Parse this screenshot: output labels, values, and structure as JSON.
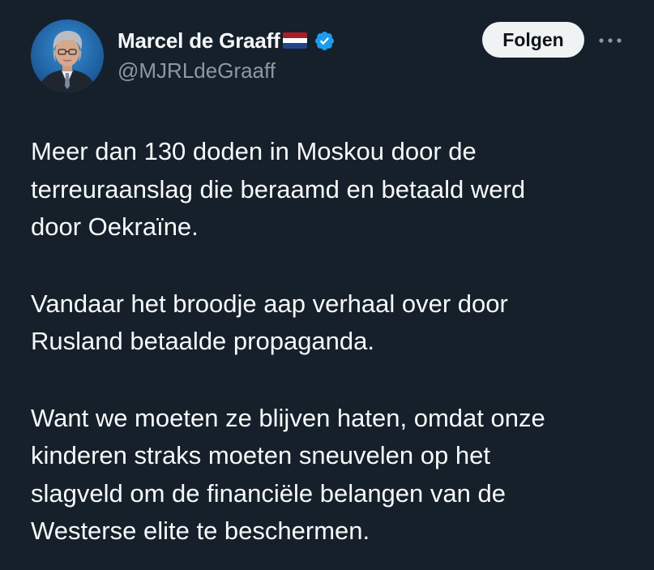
{
  "author": {
    "display_name": "Marcel de Graaff",
    "handle": "@MJRLdeGraaff",
    "flag_icon": "netherlands-flag-icon",
    "verified_icon": "verified-badge-icon"
  },
  "actions": {
    "follow_label": "Folgen",
    "more_icon": "more-options-icon"
  },
  "tweet": {
    "paragraphs": [
      "Meer dan 130 doden in Moskou door de\nterreuraanslag die beraamd en betaald werd\ndoor Oekraïne.",
      "Vandaar het broodje aap verhaal over door\nRusland betaalde propaganda.",
      "Want we moeten ze blijven haten, omdat onze\nkinderen straks moeten sneuvelen op het\nslagveld om de financiële belangen van de\nWesterse elite te beschermen."
    ]
  },
  "colors": {
    "background": "#15202b",
    "text": "#f7f9f9",
    "secondary_text": "#8b98a5",
    "verified_blue": "#1d9bf0",
    "follow_button_bg": "#eff3f4"
  }
}
